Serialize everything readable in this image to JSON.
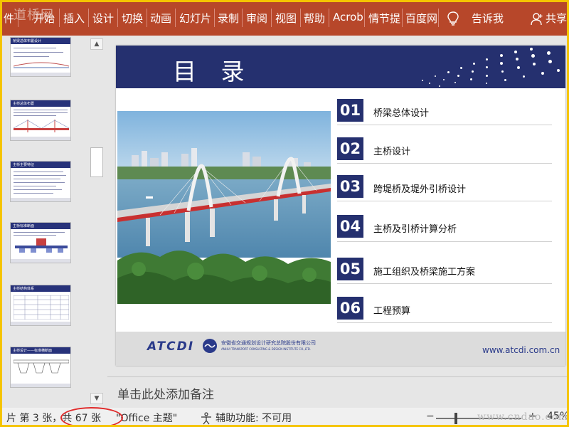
{
  "ribbon": {
    "tabs": [
      "件",
      "开始",
      "插入",
      "设计",
      "切换",
      "动画",
      "幻灯片",
      "录制",
      "审阅",
      "视图",
      "帮助",
      "Acrob",
      "情节提",
      "百度网"
    ],
    "tell_me": "告诉我",
    "share": "共享",
    "watermark": "道桥网"
  },
  "slide": {
    "title": "目 录",
    "items": [
      {
        "num": "01",
        "text": "桥梁总体设计"
      },
      {
        "num": "02",
        "text": "主桥设计"
      },
      {
        "num": "03",
        "text": "跨堤桥及堤外引桥设计"
      },
      {
        "num": "04",
        "text": "主桥及引桥计算分析"
      },
      {
        "num": "05",
        "text": "施工组织及桥梁施工方案"
      },
      {
        "num": "06",
        "text": "工程预算"
      }
    ],
    "footer": {
      "logo": "ATCDI",
      "company_cn": "安徽省交通规划设计研究总院股份有限公司",
      "company_en": "ANHUI TRANSPORT CONSULTING & DESIGN INSTITUTE CO.,LTD.",
      "website": "www.atcdi.com.cn"
    },
    "header_color": "#25306f"
  },
  "thumbnails": [
    {
      "title": "桥梁总体布置设计"
    },
    {
      "title": "主桥总体布置"
    },
    {
      "title": "主桥主要特征"
    },
    {
      "title": "主桥标准断面"
    },
    {
      "title": "主桥结构体系"
    },
    {
      "title": "主桥设计——标准横断面"
    }
  ],
  "notes": {
    "placeholder": "单击此处添加备注"
  },
  "status": {
    "slide_info": "片 第 3 张，共 67 张",
    "theme": "\"Office 主题\"",
    "accessibility": "辅助功能: 不可用",
    "zoom_minus": "−",
    "zoom_plus": "+",
    "zoom": "45%",
    "watermark": "www.cndao.com",
    "highlight_color": "#e02a2a"
  },
  "colors": {
    "ribbon": "#b7472a",
    "frame_border": "#f5c400"
  }
}
